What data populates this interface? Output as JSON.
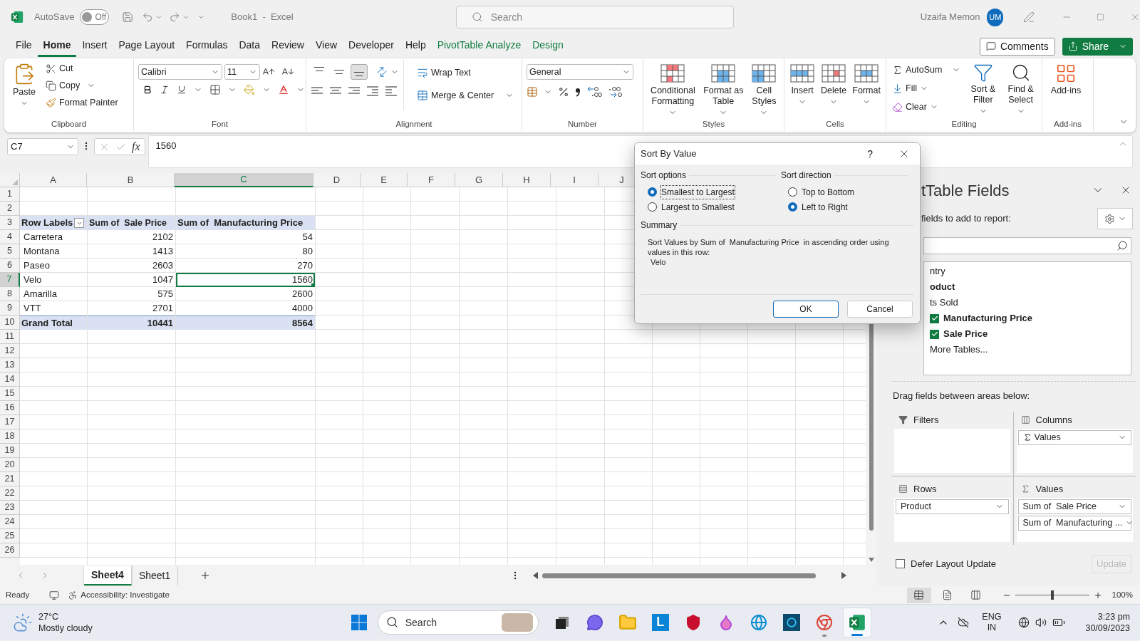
{
  "title_bar": {
    "autosave_label": "AutoSave",
    "autosave": {
      "on": false,
      "label": "Off"
    },
    "document_title": "Book1  -  Excel",
    "search": {
      "placeholder": "Search"
    },
    "user_name": "Uzaifa Memon",
    "avatar_initials": "UM"
  },
  "menu_tabs": [
    {
      "label": "File",
      "selected": false,
      "contextual": false
    },
    {
      "label": "Home",
      "selected": true,
      "contextual": false
    },
    {
      "label": "Insert",
      "selected": false,
      "contextual": false
    },
    {
      "label": "Page Layout",
      "selected": false,
      "contextual": false
    },
    {
      "label": "Formulas",
      "selected": false,
      "contextual": false
    },
    {
      "label": "Data",
      "selected": false,
      "contextual": false
    },
    {
      "label": "Review",
      "selected": false,
      "contextual": false
    },
    {
      "label": "View",
      "selected": false,
      "contextual": false
    },
    {
      "label": "Developer",
      "selected": false,
      "contextual": false
    },
    {
      "label": "Help",
      "selected": false,
      "contextual": false
    },
    {
      "label": "PivotTable Analyze",
      "selected": false,
      "contextual": true
    },
    {
      "label": "Design",
      "selected": false,
      "contextual": true
    }
  ],
  "comments_button": "Comments",
  "share_button": "Share",
  "ribbon": {
    "clipboard": {
      "label": "Clipboard",
      "paste": "Paste",
      "cut": "Cut",
      "copy": "Copy",
      "format_painter": "Format Painter"
    },
    "font": {
      "label": "Font",
      "font_name": "Calibri",
      "font_size": "11"
    },
    "alignment": {
      "label": "Alignment",
      "vertical_align": [
        {
          "selected": false
        },
        {
          "selected": false
        },
        {
          "selected": true
        }
      ],
      "wrap_text": "Wrap Text",
      "merge_center": "Merge & Center"
    },
    "number": {
      "label": "Number",
      "format": "General"
    },
    "styles": {
      "label": "Styles",
      "conditional_formatting": "Conditional Formatting",
      "format_as_table": "Format as Table",
      "cell_styles": "Cell Styles"
    },
    "cells": {
      "label": "Cells",
      "insert": "Insert",
      "delete": "Delete",
      "format": "Format"
    },
    "editing": {
      "label": "Editing",
      "autosum": "AutoSum",
      "fill": "Fill",
      "clear": "Clear",
      "sort_filter": "Sort & Filter",
      "find_select": "Find & Select"
    },
    "addins": {
      "label": "Add-ins",
      "button": "Add-ins"
    }
  },
  "formula_bar": {
    "name_box": "C7",
    "fx": "fx",
    "value": "1560"
  },
  "sheet": {
    "columns": [
      {
        "label": "A",
        "selected": false
      },
      {
        "label": "B",
        "selected": false
      },
      {
        "label": "C",
        "selected": true
      },
      {
        "label": "D",
        "selected": false
      },
      {
        "label": "E",
        "selected": false
      },
      {
        "label": "F",
        "selected": false
      },
      {
        "label": "G",
        "selected": false
      },
      {
        "label": "H",
        "selected": false
      },
      {
        "label": "I",
        "selected": false
      },
      {
        "label": "J",
        "selected": false
      }
    ],
    "rows": [
      {
        "label": "1",
        "selected": false
      },
      {
        "label": "2",
        "selected": false
      },
      {
        "label": "3",
        "selected": false
      },
      {
        "label": "4",
        "selected": false
      },
      {
        "label": "5",
        "selected": false
      },
      {
        "label": "6",
        "selected": false
      },
      {
        "label": "7",
        "selected": true
      },
      {
        "label": "8",
        "selected": false
      },
      {
        "label": "9",
        "selected": false
      },
      {
        "label": "10",
        "selected": false
      },
      {
        "label": "11",
        "selected": false
      },
      {
        "label": "12",
        "selected": false
      },
      {
        "label": "13",
        "selected": false
      },
      {
        "label": "14",
        "selected": false
      },
      {
        "label": "15",
        "selected": false
      },
      {
        "label": "16",
        "selected": false
      },
      {
        "label": "17",
        "selected": false
      },
      {
        "label": "18",
        "selected": false
      },
      {
        "label": "19",
        "selected": false
      },
      {
        "label": "20",
        "selected": false
      },
      {
        "label": "21",
        "selected": false
      },
      {
        "label": "22",
        "selected": false
      },
      {
        "label": "23",
        "selected": false
      },
      {
        "label": "24",
        "selected": false
      },
      {
        "label": "25",
        "selected": false
      },
      {
        "label": "26",
        "selected": false
      }
    ],
    "pivot": {
      "headers": [
        "Row Labels",
        "Sum of  Sale Price",
        "Sum of  Manufacturing Price"
      ],
      "rows": [
        {
          "label": "Carretera",
          "sale_price": "2102",
          "manufacturing_price": "54",
          "selected": false
        },
        {
          "label": "Montana",
          "sale_price": "1413",
          "manufacturing_price": "80",
          "selected": false
        },
        {
          "label": "Paseo",
          "sale_price": "2603",
          "manufacturing_price": "270",
          "selected": false
        },
        {
          "label": "Velo",
          "sale_price": "1047",
          "manufacturing_price": "1560",
          "selected": true
        },
        {
          "label": "Amarilla",
          "sale_price": "575",
          "manufacturing_price": "2600",
          "selected": false
        },
        {
          "label": "VTT",
          "sale_price": "2701",
          "manufacturing_price": "4000",
          "selected": false
        }
      ],
      "total": {
        "label": "Grand Total",
        "sale_price": "10441",
        "manufacturing_price": "8564"
      }
    }
  },
  "sheet_tabs": [
    {
      "label": "Sheet4",
      "selected": true
    },
    {
      "label": "Sheet1",
      "selected": false
    }
  ],
  "sort_dialog": {
    "title": "Sort By Value",
    "help": "?",
    "sort_options": {
      "label": "Sort options",
      "options": [
        {
          "label": "Smallest to Largest",
          "selected": true
        },
        {
          "label": "Largest to Smallest",
          "selected": false
        }
      ]
    },
    "sort_direction": {
      "label": "Sort direction",
      "options": [
        {
          "label": "Top to Bottom",
          "selected": false
        },
        {
          "label": "Left to Right",
          "selected": true
        }
      ]
    },
    "summary_label": "Summary",
    "summary": "Sort Values by Sum of  Manufacturing Price  in ascending order using values in this row:",
    "summary_value": "Velo",
    "ok": "OK",
    "cancel": "Cancel"
  },
  "pivot_panel": {
    "title": "tTable Fields",
    "subtitle": "fields to add to report:",
    "fields": [
      {
        "label": "ntry",
        "checked": false,
        "kind": "clipped"
      },
      {
        "label": "oduct",
        "checked": true,
        "kind": "clipped"
      },
      {
        "label": "ts Sold",
        "checked": false,
        "kind": "clipped"
      },
      {
        "label": "Manufacturing Price",
        "checked": true,
        "kind": "full"
      },
      {
        "label": "Sale Price",
        "checked": true,
        "kind": "full"
      }
    ],
    "more_tables": "More Tables...",
    "drag_hint": "Drag fields between areas below:",
    "areas": [
      {
        "kind": "filters",
        "label": "Filters"
      },
      {
        "kind": "columns",
        "label": "Columns",
        "items": [
          "Values"
        ]
      },
      {
        "kind": "rows",
        "label": "Rows",
        "items": [
          "Product"
        ]
      },
      {
        "kind": "values",
        "label": "Values",
        "items": [
          "Sum of  Sale Price",
          "Sum of  Manufacturing ..."
        ]
      }
    ],
    "defer": {
      "label": "Defer Layout Update",
      "checked": false
    },
    "update": {
      "label": "Update",
      "disabled": true
    }
  },
  "status_bar": {
    "ready": "Ready",
    "accessibility": "Accessibility: Investigate",
    "views": [
      {
        "selected": true
      },
      {
        "selected": false
      },
      {
        "selected": false
      }
    ],
    "zoom": {
      "level": 0.5,
      "reading": "100%"
    }
  },
  "taskbar": {
    "weather": {
      "temp": "27°C",
      "condition": "Mostly cloudy"
    },
    "search": {
      "placeholder": "Search"
    },
    "apps": [
      {
        "kind": "taskview",
        "open": false,
        "selected": false
      },
      {
        "kind": "chat",
        "open": false,
        "selected": false
      },
      {
        "kind": "explorer",
        "open": false,
        "selected": false
      },
      {
        "kind": "launcher",
        "label": "L",
        "open": false,
        "selected": false
      },
      {
        "kind": "shield",
        "open": false,
        "selected": false
      },
      {
        "kind": "paint",
        "open": false,
        "selected": false
      },
      {
        "kind": "edge",
        "open": false,
        "selected": false
      },
      {
        "kind": "ring",
        "open": false,
        "selected": false
      },
      {
        "kind": "chrome",
        "open": true,
        "selected": false
      },
      {
        "kind": "excel",
        "open": true,
        "selected": true
      }
    ],
    "lang": "ENG",
    "region": "IN",
    "time": "3:23 pm",
    "date": "30/09/2023"
  }
}
